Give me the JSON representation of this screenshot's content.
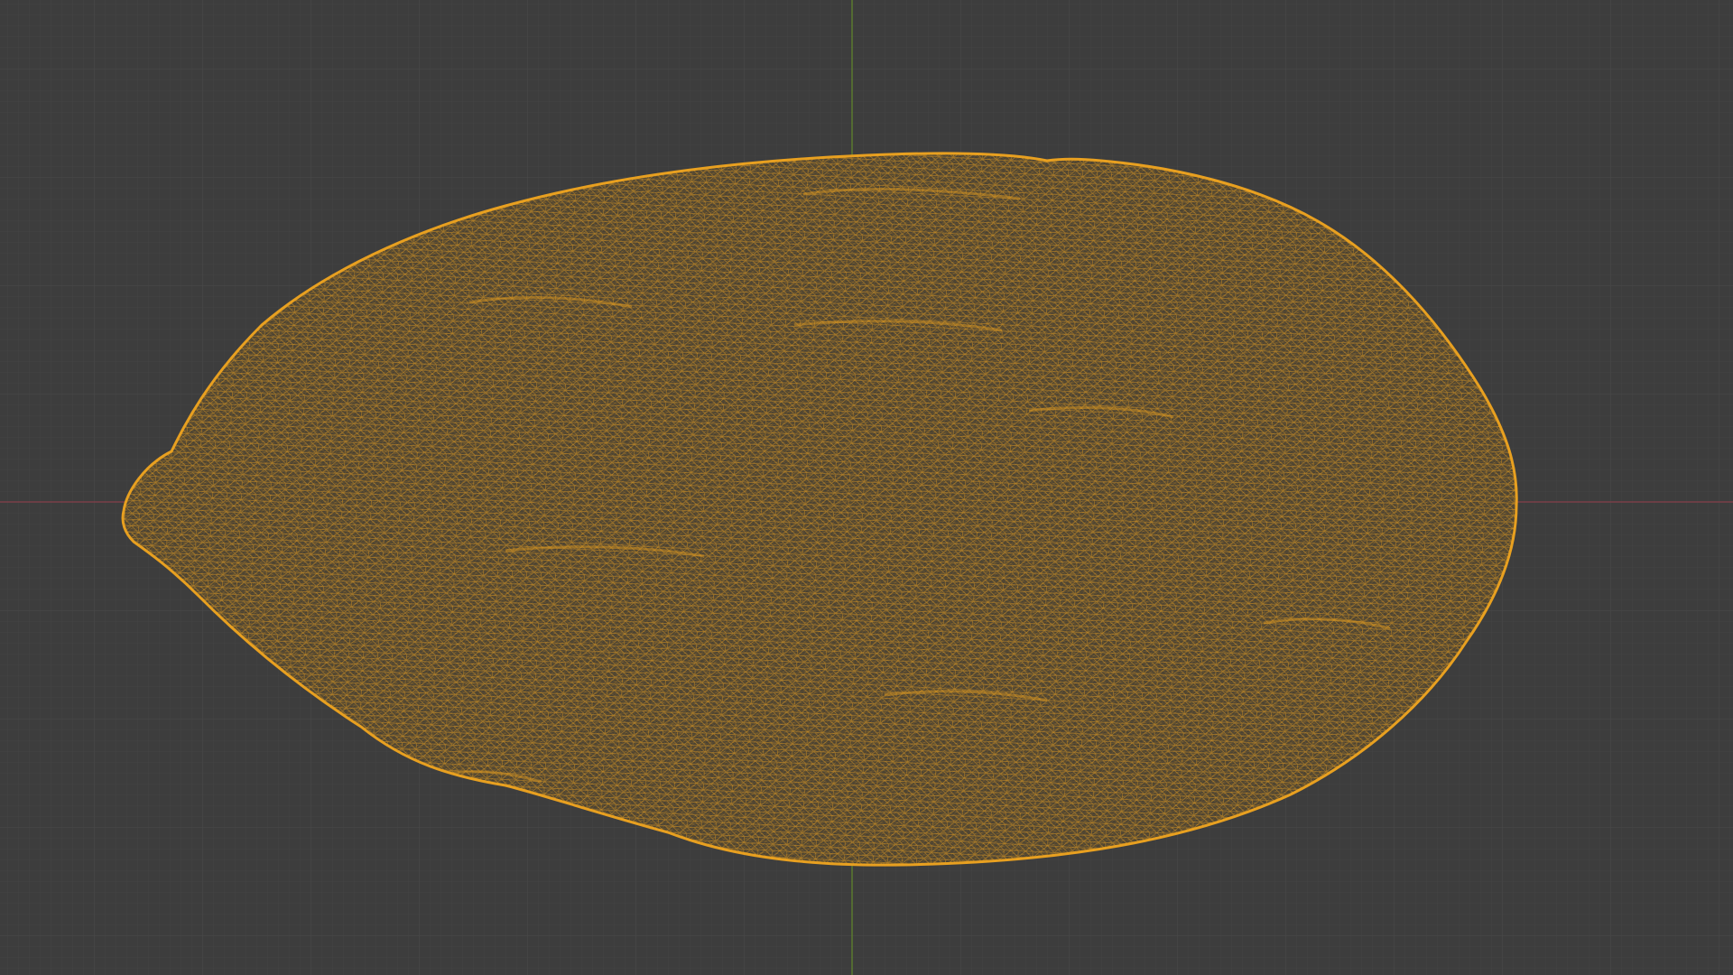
{
  "viewport": {
    "background_color": "#3d3d3d",
    "grid_minor_color": "#444444",
    "grid_major_color": "#4a4a4a",
    "x_axis_color": "#7a3f48",
    "y_axis_color": "#5b7a2f",
    "wire_color": "#e8a020",
    "object_selected": true,
    "display_mode": "wireframe",
    "object_icon": "mesh-object-icon"
  }
}
